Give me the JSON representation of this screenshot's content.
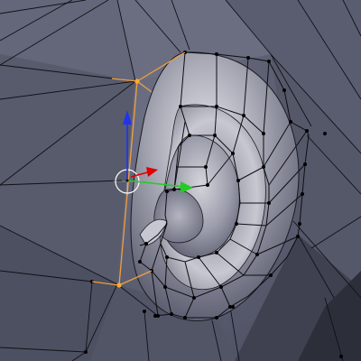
{
  "viewport": {
    "name": "3d-viewport",
    "background_color": "#5d6074",
    "mesh_color": "#8e8f9b",
    "wire_color": "#000000",
    "selected_edge_color": "#f0a040",
    "selected_vertex_color": "#ffaa33"
  },
  "transform_gizmo": {
    "x_axis_color": "#dd0000",
    "y_axis_color": "#22cc22",
    "z_axis_color": "#2233ee"
  },
  "cursor_3d": {
    "color": "#ffffff"
  }
}
